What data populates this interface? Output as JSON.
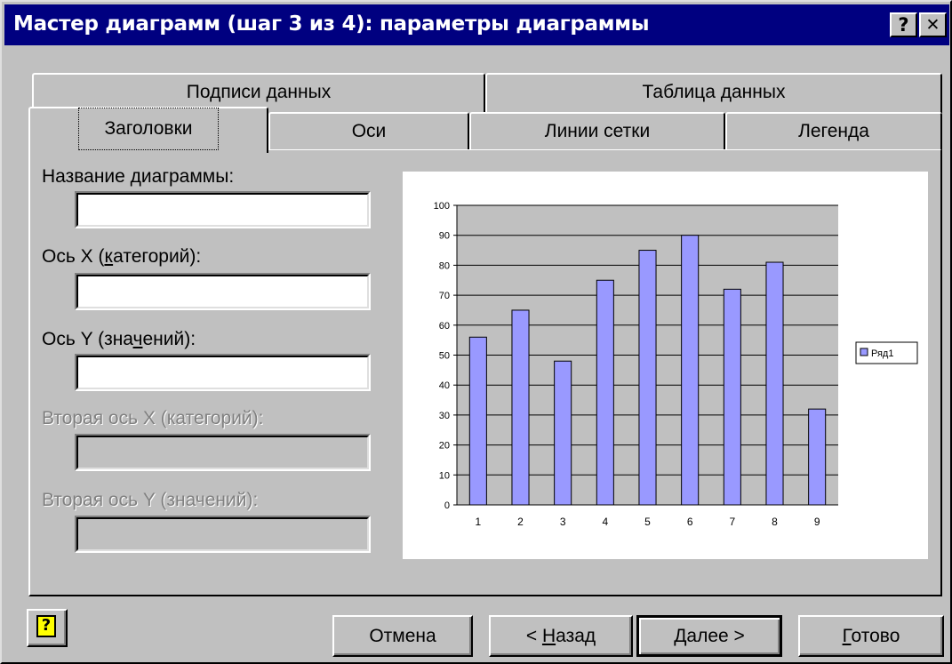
{
  "window": {
    "title": "Мастер диаграмм (шаг 3 из 4): параметры диаграммы",
    "help_glyph": "?",
    "close_glyph": "✕"
  },
  "tabs_back": [
    {
      "label": "Подписи данных"
    },
    {
      "label": "Таблица данных"
    }
  ],
  "tabs_front": [
    {
      "label": "Заголовки",
      "selected": true
    },
    {
      "label": "Оси"
    },
    {
      "label": "Линии сетки"
    },
    {
      "label": "Легенда"
    }
  ],
  "fields": {
    "chart_title": {
      "label": "Название диаграммы:",
      "value": ""
    },
    "x_axis": {
      "label_pre": "Ось X (",
      "label_u": "к",
      "label_post": "атегорий):",
      "value": ""
    },
    "y_axis": {
      "label_pre": "Ось Y (зна",
      "label_u": "ч",
      "label_post": "ений):",
      "value": ""
    },
    "x2_axis": {
      "label": "Вторая ось X (категорий):",
      "value": "",
      "disabled": true
    },
    "y2_axis": {
      "label": "Вторая ось Y (значений):",
      "value": "",
      "disabled": true
    }
  },
  "chart_data": {
    "type": "bar",
    "categories": [
      "1",
      "2",
      "3",
      "4",
      "5",
      "6",
      "7",
      "8",
      "9"
    ],
    "series": [
      {
        "name": "Ряд1",
        "values": [
          56,
          65,
          48,
          75,
          85,
          90,
          72,
          81,
          32
        ]
      }
    ],
    "y_ticks": [
      "0",
      "10",
      "20",
      "30",
      "40",
      "50",
      "60",
      "70",
      "80",
      "90",
      "100"
    ],
    "ylim": [
      0,
      100
    ],
    "grid": true,
    "legend": "right",
    "colors": {
      "bar": "#9999ff",
      "plot_bg": "#c0c0c0"
    }
  },
  "buttons": {
    "cancel": "Отмена",
    "back_pre": "< ",
    "back_u": "Н",
    "back_post": "азад",
    "next": "Далее >",
    "finish_u": "Г",
    "finish_post": "отово",
    "help_glyph": "?"
  }
}
